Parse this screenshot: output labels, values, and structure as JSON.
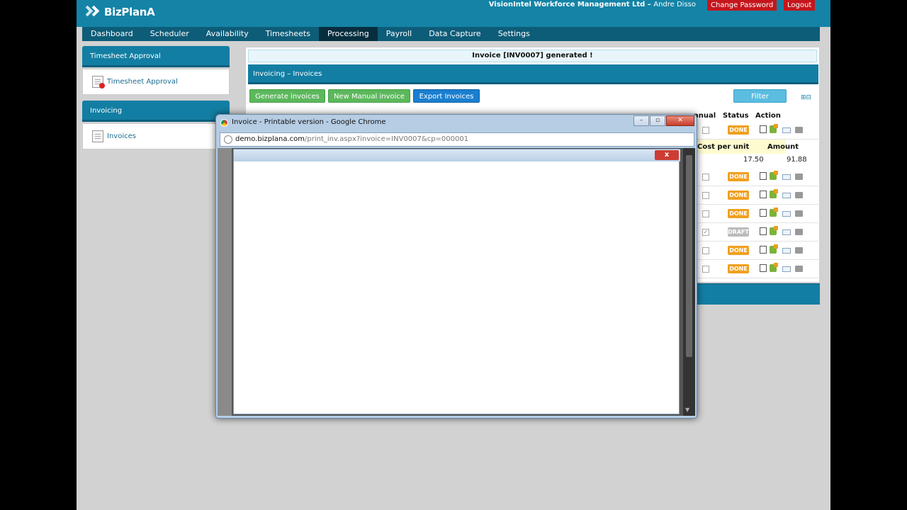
{
  "header": {
    "logo_text": "BizPlanA",
    "company": "VisionIntel Workforce Management Ltd",
    "separator": "–",
    "user": "Andre Disso",
    "change_password": "Change Password",
    "logout": "Logout"
  },
  "nav": {
    "items": [
      "Dashboard",
      "Scheduler",
      "Availability",
      "Timesheets",
      "Processing",
      "Payroll",
      "Data Capture",
      "Settings"
    ],
    "active": "Processing"
  },
  "sidebar": {
    "panels": [
      {
        "title": "Timesheet Approval",
        "link": "Timesheet Approval"
      },
      {
        "title": "Invoicing",
        "link": "Invoices"
      }
    ]
  },
  "main": {
    "notice": "Invoice [INV0007] generated !",
    "section_title": "Invoicing – Invoices",
    "buttons": {
      "generate": "Generate invoices",
      "new_manual": "New Manual invoice",
      "export": "Export Invoices",
      "filter": "Filter"
    },
    "expand_icons": "⊞⊟",
    "columns": {
      "manual": "anual",
      "status": "Status",
      "action": "Action"
    },
    "sub_table": {
      "cost_per_unit_header": "Cost per unit",
      "amount_header": "Amount",
      "cost_per_unit": "17.50",
      "amount": "91.88"
    },
    "rows": [
      {
        "status": "DONE",
        "manual": false
      },
      {
        "status": "DONE",
        "manual": false
      },
      {
        "status": "DONE",
        "manual": false
      },
      {
        "status": "DONE",
        "manual": false
      },
      {
        "status": "DRAFT",
        "manual": true
      },
      {
        "status": "DONE",
        "manual": false
      },
      {
        "status": "DONE",
        "manual": false
      }
    ]
  },
  "chrome_window": {
    "title": "Invoice - Printable version - Google Chrome",
    "url_host": "demo.bizplana.com",
    "url_path": "/print_inv.aspx?invoice=INV0007&cp=000001",
    "popup_close": "x"
  }
}
